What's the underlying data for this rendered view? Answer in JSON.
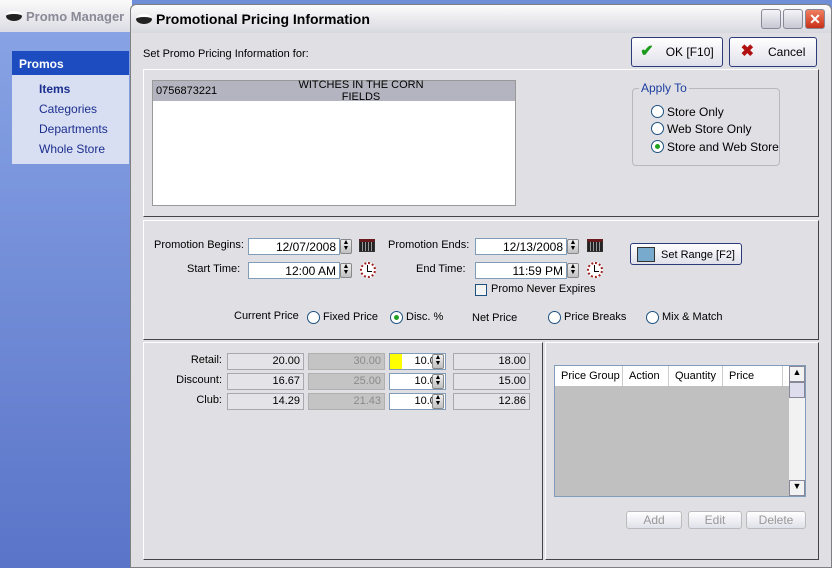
{
  "bg_window": {
    "title": "Promo Manager",
    "section": "Promos",
    "items": [
      {
        "label": "Items",
        "active": true
      },
      {
        "label": "Categories"
      },
      {
        "label": "Departments"
      },
      {
        "label": "Whole Store"
      }
    ]
  },
  "dialog": {
    "title": "Promotional Pricing Information",
    "set_for_label": "Set Promo Pricing Information for:",
    "ok_label": "OK [F10]",
    "cancel_label": "Cancel",
    "item": {
      "code": "0756873221",
      "name": "WITCHES IN THE CORN FIELDS"
    },
    "apply_to": {
      "title": "Apply To",
      "options": [
        "Store Only",
        "Web Store Only",
        "Store and Web Store"
      ],
      "selected": "Store and Web Store"
    },
    "dates": {
      "begins_label": "Promotion Begins:",
      "begins": "12/07/2008",
      "ends_label": "Promotion Ends:",
      "ends": "12/13/2008",
      "start_label": "Start Time:",
      "start": "12:00 AM",
      "end_label": "End Time:",
      "end": "11:59 PM",
      "set_range_label": "Set Range [F2]",
      "never_expires_label": "Promo Never Expires",
      "never_expires": false
    },
    "pricing_type": {
      "current_price_label": "Current Price",
      "net_price_label": "Net Price",
      "options": [
        "Fixed Price",
        "Disc. %",
        "Price Breaks",
        "Mix & Match"
      ],
      "selected": "Disc. %"
    },
    "prices": [
      {
        "label": "Retail:",
        "current": "20.00",
        "fixed": "30.00",
        "disc": "10.00",
        "net": "18.00"
      },
      {
        "label": "Discount:",
        "current": "16.67",
        "fixed": "25.00",
        "disc": "10.00",
        "net": "15.00"
      },
      {
        "label": "Club:",
        "current": "14.29",
        "fixed": "21.43",
        "disc": "10.00",
        "net": "12.86"
      }
    ],
    "breaks_table": {
      "columns": [
        "Price Group",
        "Action",
        "Quantity",
        "Price"
      ],
      "rows": []
    },
    "breaks_buttons": {
      "add": "Add",
      "edit": "Edit",
      "delete": "Delete"
    },
    "highlight_color": "#ffff00"
  }
}
